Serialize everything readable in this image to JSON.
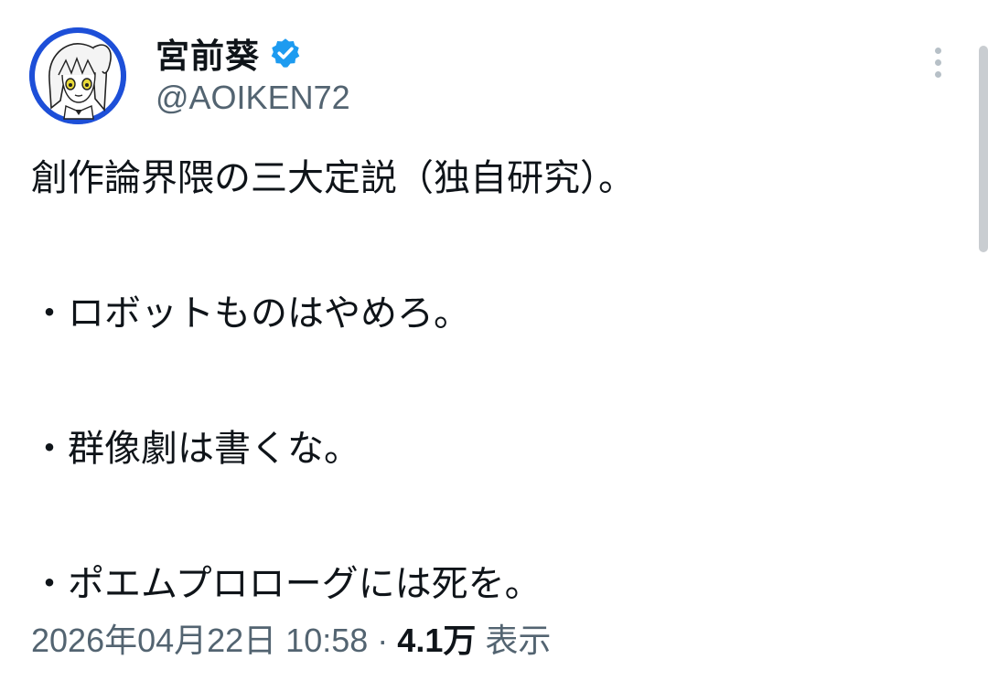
{
  "author": {
    "display_name": "宮前葵",
    "handle": "@AOIKEN72",
    "verified": true
  },
  "tweet": {
    "lines": [
      "創作論界隈の三大定説（独自研究）。",
      "",
      "・ロボットものはやめろ。",
      "",
      "・群像劇は書くな。",
      "",
      "・ポエムプロローグには死を。"
    ]
  },
  "meta": {
    "timestamp": "2026年04月22日 10:58",
    "separator": "·",
    "views_count": "4.1万",
    "views_label": "表示"
  },
  "icons": {
    "verified": "verified-badge-icon",
    "more": "more-vertical-icon"
  },
  "colors": {
    "accent": "#1d9bf0",
    "avatar_ring": "#1d4fd8",
    "secondary_text": "#536471"
  }
}
